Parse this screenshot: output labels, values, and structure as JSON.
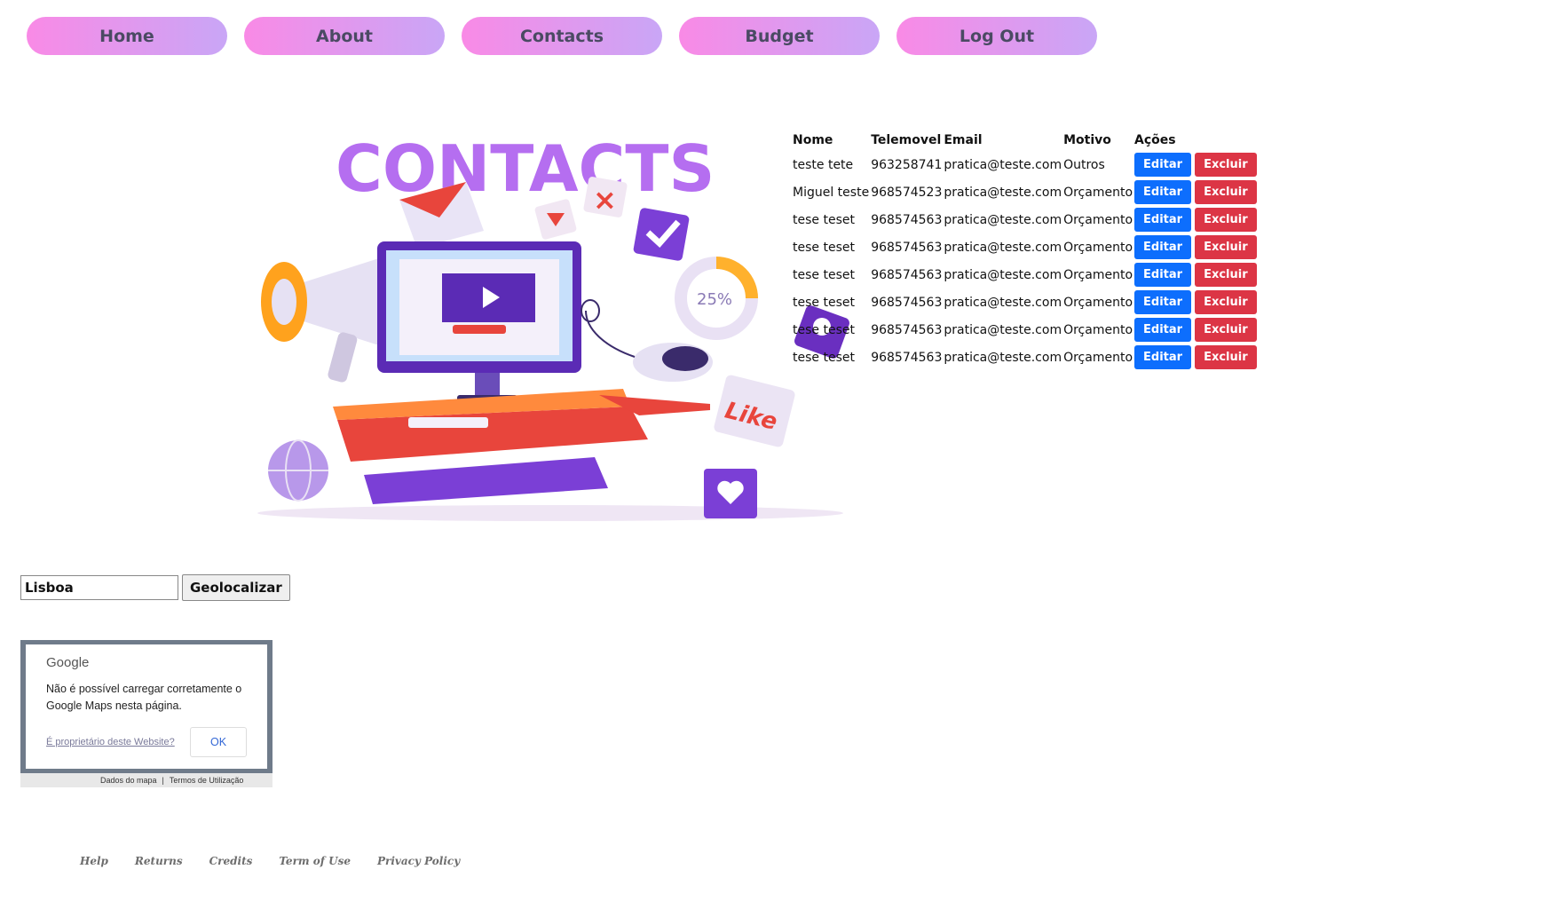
{
  "nav": {
    "items": [
      "Home",
      "About",
      "Contacts",
      "Budget",
      "Log Out"
    ]
  },
  "hero": {
    "title": "CONTACTS",
    "percent": "25%",
    "like": "Like"
  },
  "table": {
    "headers": [
      "Nome",
      "Telemovel",
      "Email",
      "Motivo",
      "Ações"
    ],
    "rows": [
      {
        "nome": "teste tete",
        "telemovel": "963258741",
        "email": "pratica@teste.com",
        "motivo": "Outros"
      },
      {
        "nome": "Miguel teste",
        "telemovel": "968574523",
        "email": "pratica@teste.com",
        "motivo": "Orçamento"
      },
      {
        "nome": "tese teset",
        "telemovel": "968574563",
        "email": "pratica@teste.com",
        "motivo": "Orçamento"
      },
      {
        "nome": "tese teset",
        "telemovel": "968574563",
        "email": "pratica@teste.com",
        "motivo": "Orçamento"
      },
      {
        "nome": "tese teset",
        "telemovel": "968574563",
        "email": "pratica@teste.com",
        "motivo": "Orçamento"
      },
      {
        "nome": "tese teset",
        "telemovel": "968574563",
        "email": "pratica@teste.com",
        "motivo": "Orçamento"
      },
      {
        "nome": "tese teset",
        "telemovel": "968574563",
        "email": "pratica@teste.com",
        "motivo": "Orçamento"
      },
      {
        "nome": "tese teset",
        "telemovel": "968574563",
        "email": "pratica@teste.com",
        "motivo": "Orçamento"
      }
    ],
    "edit_label": "Editar",
    "delete_label": "Excluir"
  },
  "geo": {
    "input_value": "Lisboa",
    "button_label": "Geolocalizar"
  },
  "map": {
    "logo": "Google",
    "message": "Não é possível carregar corretamente o Google Maps nesta página.",
    "owner_link": "É proprietário deste Website?",
    "ok_label": "OK",
    "map_data": "Dados do mapa",
    "terms": "Termos de Utilização"
  },
  "footer": {
    "links": [
      "Help",
      "Returns",
      "Credits",
      "Term of Use",
      "Privacy Policy"
    ]
  },
  "colors": {
    "nav_gradient_start": "#f98ae6",
    "nav_gradient_end": "#c9a6f6",
    "edit": "#0d6efd",
    "delete": "#dc3545",
    "title": "#b56ef0"
  }
}
